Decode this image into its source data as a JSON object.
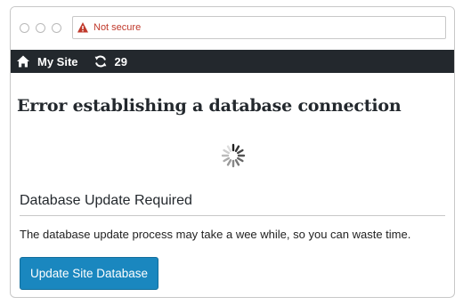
{
  "browser": {
    "security_label": "Not secure",
    "security_color": "#c0392b",
    "icons": [
      "window-close-dot",
      "window-minimize-dot",
      "window-maximize-dot",
      "warning-icon"
    ]
  },
  "admin_bar": {
    "site_name": "My Site",
    "updates_count": "29",
    "icons": [
      "home-icon",
      "refresh-icon"
    ],
    "background": "#23282d"
  },
  "main": {
    "error_title": "Error establishing a database connection",
    "section_title": "Database Update Required",
    "description": "The database update process may take a wee while, so you can waste time.",
    "update_button_label": "Update Site Database",
    "button_color": "#1a87bf"
  }
}
